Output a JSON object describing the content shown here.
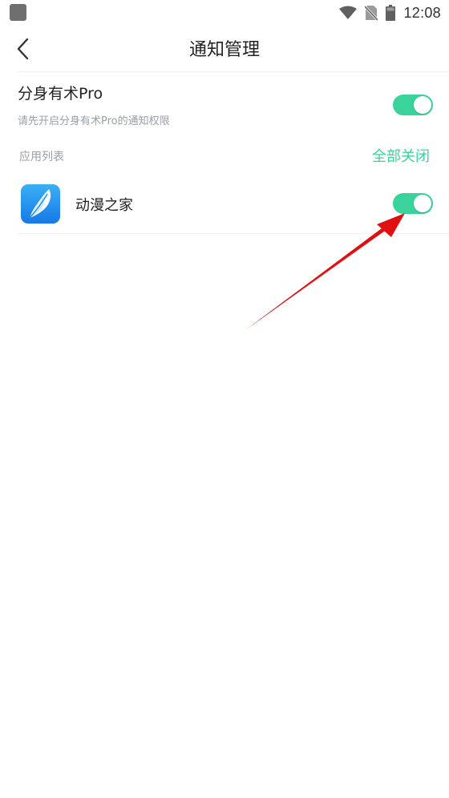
{
  "status_bar": {
    "time": "12:08",
    "icons": [
      "wifi-icon",
      "no-sim-icon",
      "battery-icon"
    ]
  },
  "header": {
    "title": "通知管理",
    "back_icon": "chevron-left-icon"
  },
  "master": {
    "title": "分身有术Pro",
    "subtitle": "请先开启分身有术Pro的通知权限",
    "enabled": true
  },
  "list": {
    "label": "应用列表",
    "close_all": "全部关闭",
    "apps": [
      {
        "name": "动漫之家",
        "icon": "feather-app-icon",
        "enabled": true
      }
    ]
  },
  "colors": {
    "accent": "#3ad39b",
    "annotation": "#e01010"
  }
}
